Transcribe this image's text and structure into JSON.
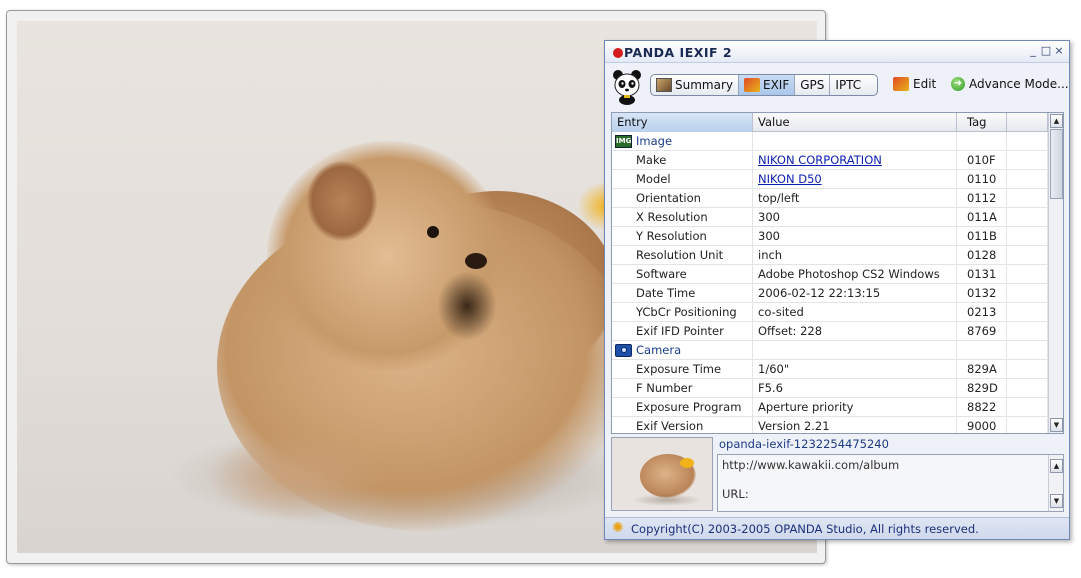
{
  "app": {
    "title": "OPANDA IEXIF 2",
    "title_rest": "PANDA IEXIF 2",
    "window_buttons": [
      "_",
      "□",
      "×"
    ]
  },
  "toolbar": {
    "tabs": [
      {
        "label": "Summary",
        "icon": "summary-icon",
        "active": false
      },
      {
        "label": "EXIF",
        "icon": "exif-icon",
        "active": true
      },
      {
        "label": "GPS",
        "active": false
      },
      {
        "label": "IPTC",
        "active": false
      }
    ],
    "edit_label": "Edit",
    "advance_label": "Advance Mode..."
  },
  "grid": {
    "columns": [
      "Entry",
      "Value",
      "Tag",
      ""
    ],
    "groups": [
      {
        "name": "Image",
        "icon": "image-icon"
      },
      {
        "name": "Camera",
        "icon": "camera-icon"
      }
    ],
    "image_rows": [
      {
        "entry": "Make",
        "value": "NIKON CORPORATION",
        "tag": "010F",
        "link": true
      },
      {
        "entry": "Model",
        "value": "NIKON D50",
        "tag": "0110",
        "link": true
      },
      {
        "entry": "Orientation",
        "value": "top/left",
        "tag": "0112"
      },
      {
        "entry": "X Resolution",
        "value": "300",
        "tag": "011A"
      },
      {
        "entry": "Y Resolution",
        "value": "300",
        "tag": "011B"
      },
      {
        "entry": "Resolution Unit",
        "value": "inch",
        "tag": "0128"
      },
      {
        "entry": "Software",
        "value": "Adobe Photoshop CS2 Windows",
        "tag": "0131"
      },
      {
        "entry": "Date Time",
        "value": "2006-02-12 22:13:15",
        "tag": "0132"
      },
      {
        "entry": "YCbCr Positioning",
        "value": "co-sited",
        "tag": "0213"
      },
      {
        "entry": "Exif IFD Pointer",
        "value": "Offset: 228",
        "tag": "8769"
      }
    ],
    "camera_rows": [
      {
        "entry": "Exposure Time",
        "value": "1/60\"",
        "tag": "829A"
      },
      {
        "entry": "F Number",
        "value": "F5.6",
        "tag": "829D"
      },
      {
        "entry": "Exposure Program",
        "value": "Aperture priority",
        "tag": "8822"
      },
      {
        "entry": "Exif Version",
        "value": "Version 2.21",
        "tag": "9000"
      }
    ]
  },
  "preview": {
    "file_name": "opanda-iexif-1232254475240",
    "url_text": "http://www.kawakii.com/album",
    "url_label": "URL:"
  },
  "status": {
    "copyright": "Copyright(C) 2003-2005 OPANDA Studio, All rights reserved."
  },
  "colors": {
    "accent": "#1a3c8c",
    "link": "#0b1fb3",
    "logo_red": "#d41c1c"
  }
}
